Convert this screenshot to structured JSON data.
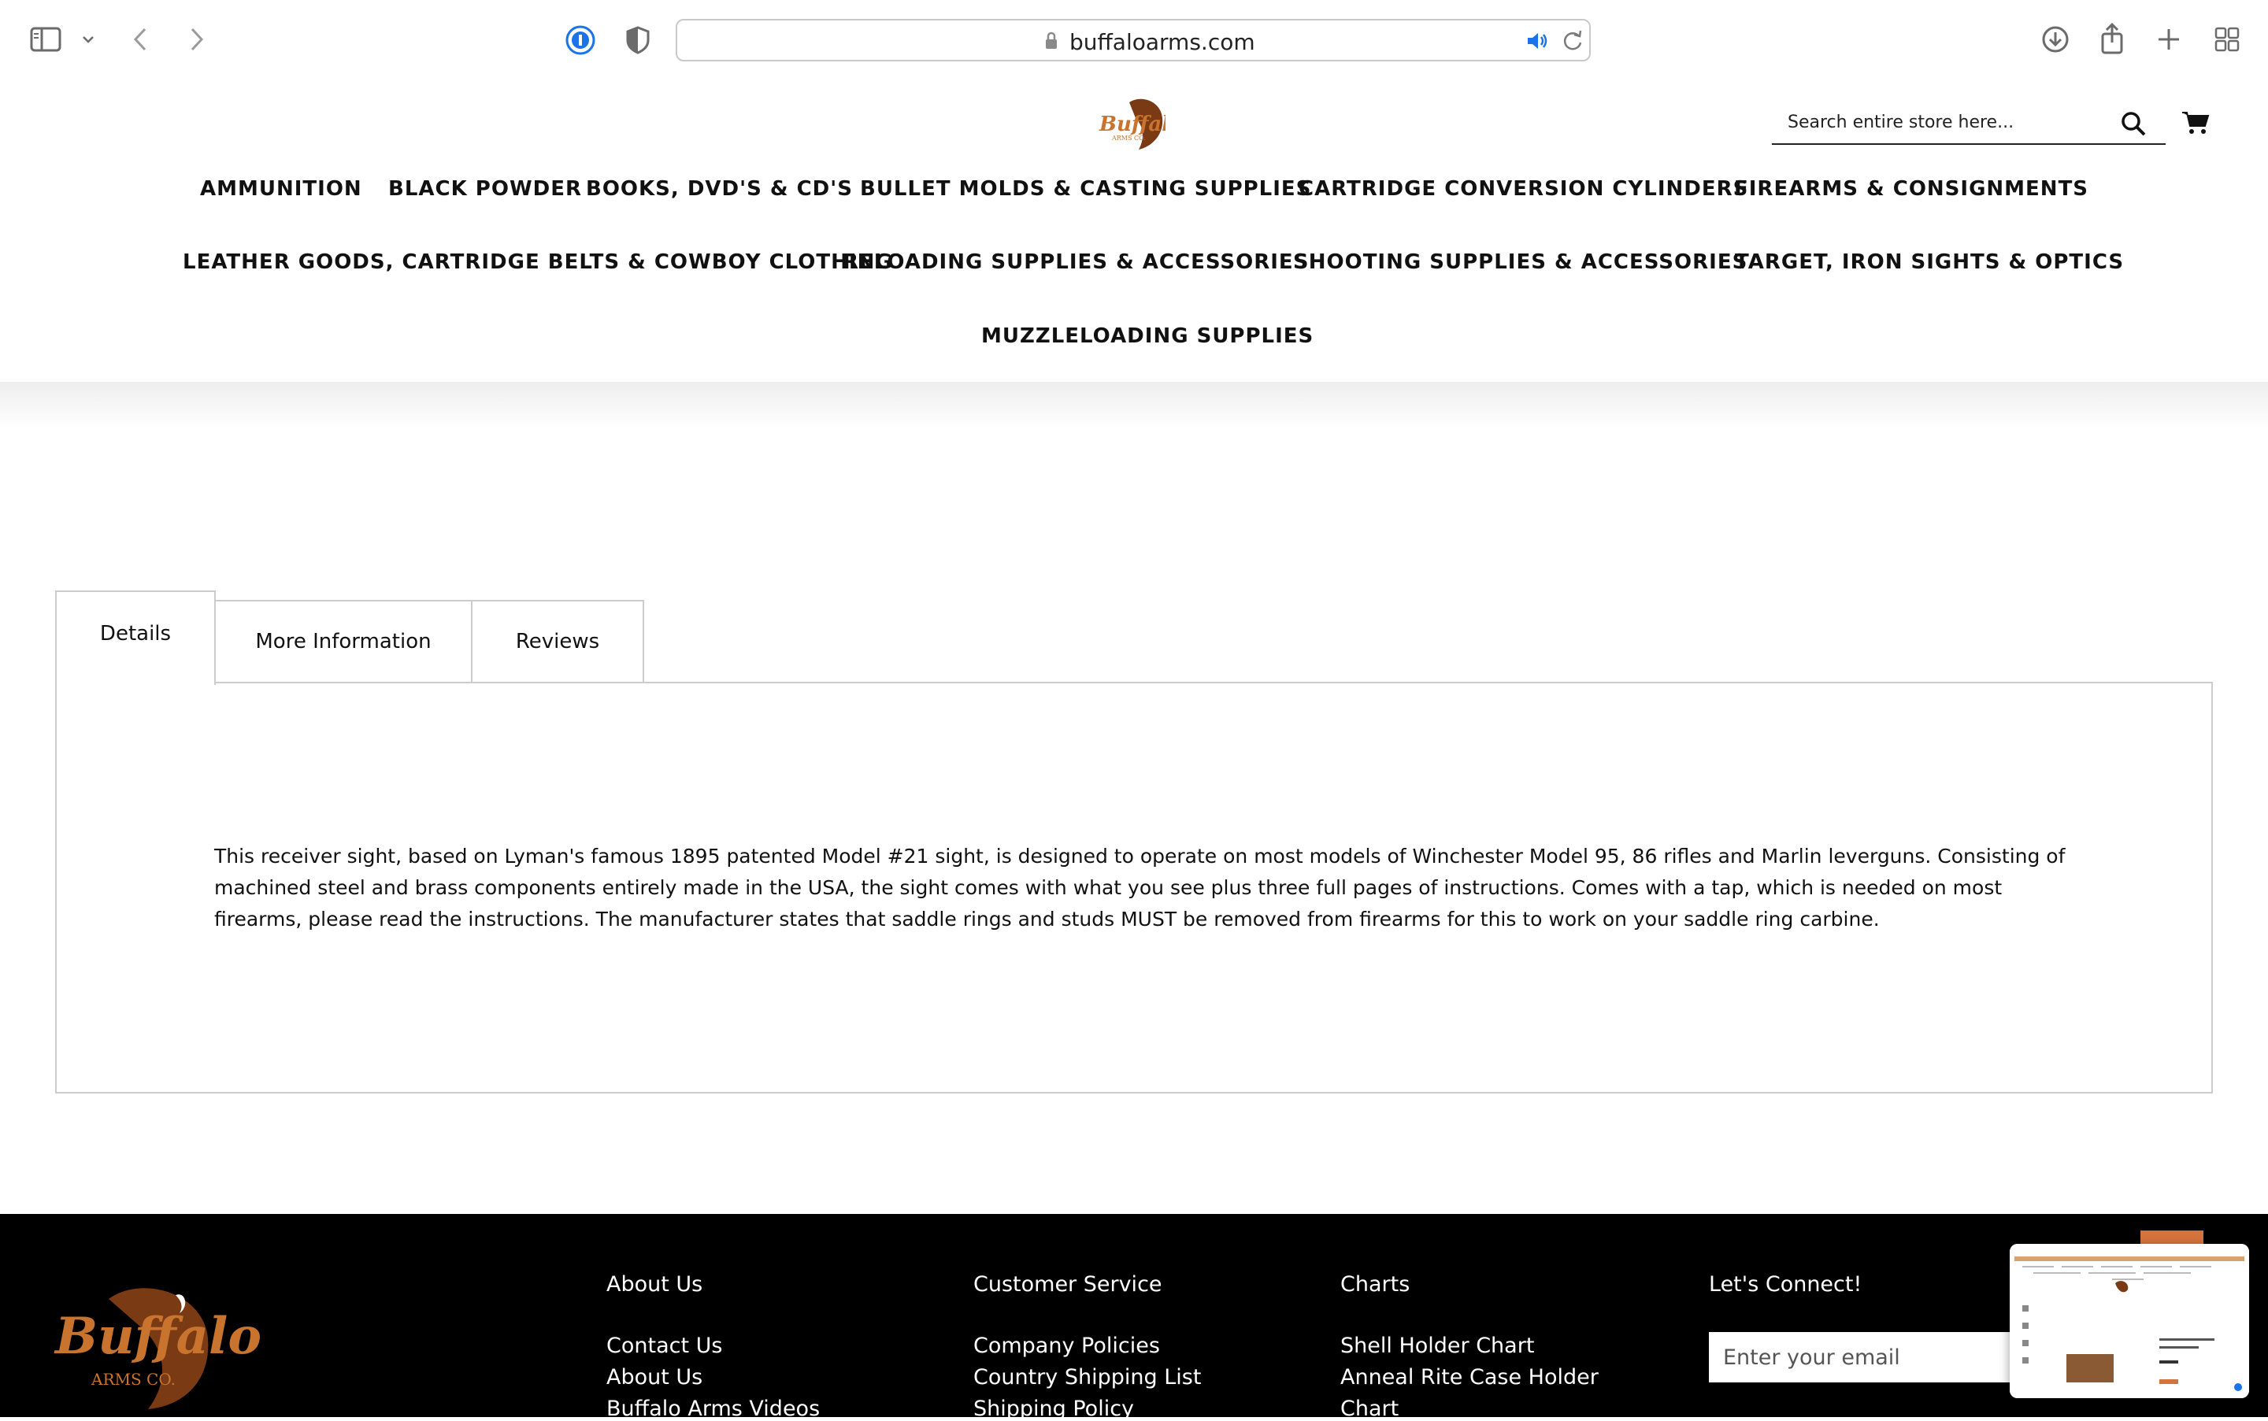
{
  "browser": {
    "url": "buffaloarms.com"
  },
  "header": {
    "search_placeholder": "Search entire store here...",
    "nav_row1": [
      "AMMUNITION",
      "BLACK POWDER",
      "BOOKS, DVD'S & CD'S",
      "BULLET MOLDS & CASTING SUPPLIES",
      "CARTRIDGE CONVERSION CYLINDERS",
      "FIREARMS & CONSIGNMENTS"
    ],
    "nav_row2": [
      "LEATHER GOODS, CARTRIDGE BELTS & COWBOY CLOTHING",
      "RELOADING SUPPLIES & ACCESSORIES",
      "SHOOTING SUPPLIES & ACCESSORIES",
      "TARGET, IRON SIGHTS & OPTICS"
    ],
    "nav_row3": [
      "MUZZLELOADING SUPPLIES"
    ]
  },
  "tabs": [
    {
      "label": "Details",
      "active": true
    },
    {
      "label": "More Information",
      "active": false
    },
    {
      "label": "Reviews",
      "active": false
    }
  ],
  "details": {
    "text": "This receiver sight, based on Lyman's famous 1895 patented Model #21 sight, is designed to operate on most models of Winchester Model 95, 86 rifles and Marlin leverguns. Consisting of machined steel and brass components entirely made in the USA, the sight comes with what you see plus three full pages of instructions. Comes with a tap, which is needed on most firearms, please read the instructions. The manufacturer states that saddle rings and studs MUST be removed from firearms for this to work on your saddle ring carbine."
  },
  "footer": {
    "logo_text": "Buffalo",
    "logo_subtext": "ARMS CO.",
    "about": {
      "title": "About Us",
      "links": [
        "Contact Us",
        "About Us",
        "Buffalo Arms Videos"
      ]
    },
    "service": {
      "title": "Customer Service",
      "links": [
        "Company Policies",
        "Country Shipping List",
        "Shipping Policy"
      ]
    },
    "charts": {
      "title": "Charts",
      "links": [
        "Shell Holder Chart",
        "Anneal Rite Case Holder",
        "Chart"
      ]
    },
    "connect": {
      "title": "Let's Connect!",
      "email_placeholder": "Enter your email"
    }
  },
  "colors": {
    "brand_orange": "#c8742e",
    "footer_bg": "#000000",
    "accent_blue": "#1a73e8"
  }
}
